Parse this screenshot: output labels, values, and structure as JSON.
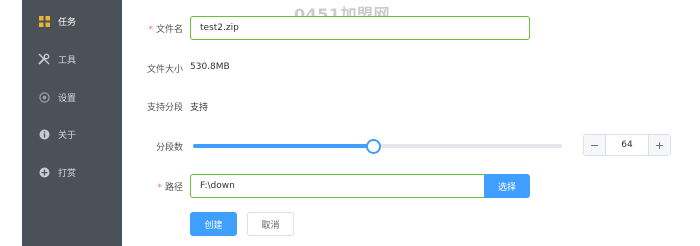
{
  "watermark": "0451加盟网",
  "sidebar": {
    "items": [
      {
        "label": "任务",
        "icon": "grid-icon",
        "active": true
      },
      {
        "label": "工具",
        "icon": "tools-icon"
      },
      {
        "label": "设置",
        "icon": "settings-icon"
      },
      {
        "label": "关于",
        "icon": "info-icon"
      },
      {
        "label": "打赏",
        "icon": "reward-icon"
      }
    ]
  },
  "form": {
    "file_name": {
      "label": "文件名",
      "required": "*",
      "value": "test2.zip"
    },
    "file_size": {
      "label": "文件大小",
      "value": "530.8MB"
    },
    "segment_support": {
      "label": "支持分段",
      "value": "支持"
    },
    "segments": {
      "label": "分段数",
      "value": "64",
      "slider_fraction": 0.49
    },
    "path": {
      "label": "路径",
      "required": "*",
      "value": "F:\\down",
      "select_label": "选择"
    },
    "create_label": "创建",
    "cancel_label": "取消"
  },
  "colors": {
    "accent": "#409eff",
    "success_border": "#67c23a",
    "sidebar_bg": "#4a5159",
    "required": "#f56c6c"
  }
}
